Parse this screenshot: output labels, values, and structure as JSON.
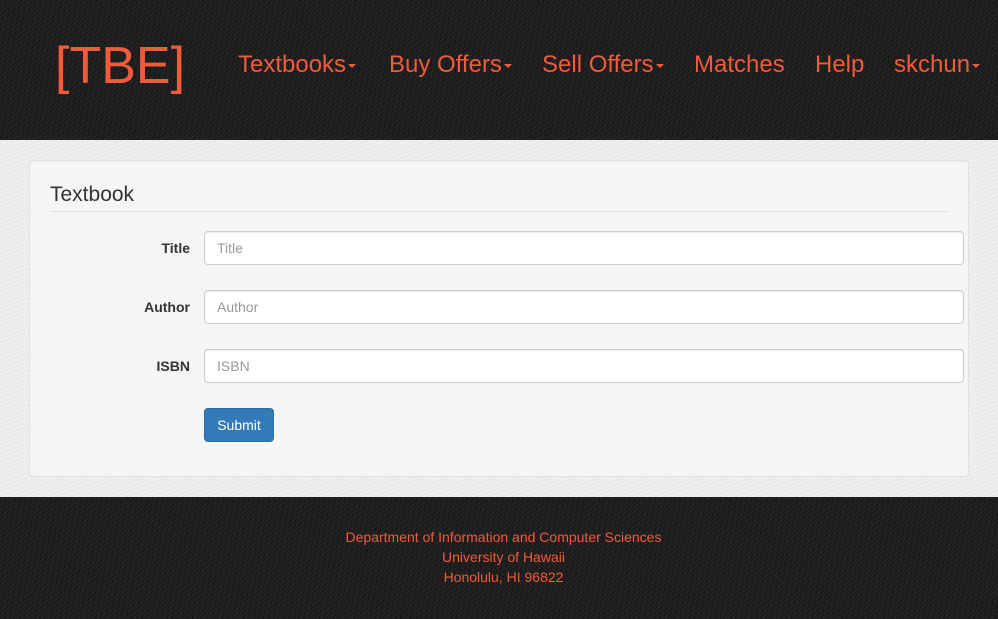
{
  "colors": {
    "accent": "#f15a3b",
    "header_bg": "#1c1c1c",
    "panel_bg": "#f5f5f5",
    "button_bg": "#337ab7"
  },
  "header": {
    "brand": "[TBE]",
    "nav": [
      {
        "label": "Textbooks",
        "dropdown": true
      },
      {
        "label": "Buy Offers",
        "dropdown": true
      },
      {
        "label": "Sell Offers",
        "dropdown": true
      },
      {
        "label": "Matches",
        "dropdown": false
      },
      {
        "label": "Help",
        "dropdown": false
      },
      {
        "label": "skchun",
        "dropdown": true
      }
    ]
  },
  "form": {
    "legend": "Textbook",
    "fields": [
      {
        "label": "Title",
        "placeholder": "Title",
        "value": ""
      },
      {
        "label": "Author",
        "placeholder": "Author",
        "value": ""
      },
      {
        "label": "ISBN",
        "placeholder": "ISBN",
        "value": ""
      }
    ],
    "submit_label": "Submit"
  },
  "footer": {
    "lines": [
      "Department of Information and Computer Sciences",
      "University of Hawaii",
      "Honolulu, HI 96822"
    ]
  }
}
